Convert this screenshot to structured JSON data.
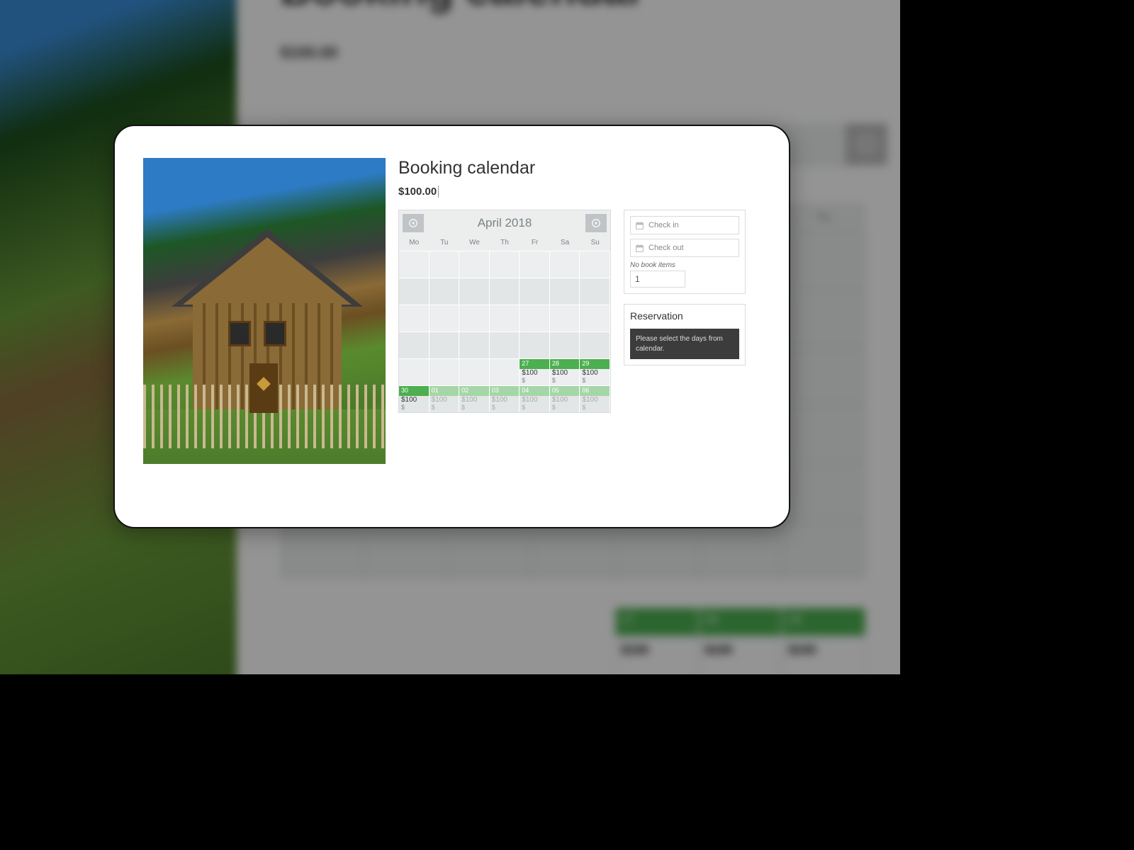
{
  "bg": {
    "title": "Booking calendar",
    "price": "$100.00",
    "dow": [
      "Mo",
      "Tu",
      "We",
      "Th",
      "Fr",
      "Sa",
      "Su"
    ],
    "avail_days": [
      "27",
      "28",
      "29"
    ],
    "avail_prices": [
      "$100",
      "$100",
      "$100"
    ]
  },
  "product": {
    "title": "Booking calendar",
    "price": "$100.00"
  },
  "calendar": {
    "month_label": "April 2018",
    "dow": [
      "Mo",
      "Tu",
      "We",
      "Th",
      "Fr",
      "Sa",
      "Su"
    ],
    "weeks": [
      [
        {
          "day": "",
          "type": "row-odd"
        },
        {
          "day": "",
          "type": "row-odd"
        },
        {
          "day": "",
          "type": "row-odd"
        },
        {
          "day": "",
          "type": "row-odd"
        },
        {
          "day": "",
          "type": "row-odd"
        },
        {
          "day": "",
          "type": "row-odd"
        },
        {
          "day": "",
          "type": "row-odd"
        }
      ],
      [
        {
          "day": "",
          "type": ""
        },
        {
          "day": "",
          "type": ""
        },
        {
          "day": "",
          "type": ""
        },
        {
          "day": "",
          "type": ""
        },
        {
          "day": "",
          "type": ""
        },
        {
          "day": "",
          "type": ""
        },
        {
          "day": "",
          "type": ""
        }
      ],
      [
        {
          "day": "",
          "type": "row-odd"
        },
        {
          "day": "",
          "type": "row-odd"
        },
        {
          "day": "",
          "type": "row-odd"
        },
        {
          "day": "",
          "type": "row-odd"
        },
        {
          "day": "",
          "type": "row-odd"
        },
        {
          "day": "",
          "type": "row-odd"
        },
        {
          "day": "",
          "type": "row-odd"
        }
      ],
      [
        {
          "day": "",
          "type": ""
        },
        {
          "day": "",
          "type": ""
        },
        {
          "day": "",
          "type": ""
        },
        {
          "day": "",
          "type": ""
        },
        {
          "day": "",
          "type": ""
        },
        {
          "day": "",
          "type": ""
        },
        {
          "day": "",
          "type": ""
        }
      ],
      [
        {
          "day": "",
          "type": "row-odd"
        },
        {
          "day": "",
          "type": "row-odd"
        },
        {
          "day": "",
          "type": "row-odd"
        },
        {
          "day": "",
          "type": "row-odd"
        },
        {
          "day": "27",
          "type": "row-odd avail",
          "price": "$100",
          "price2": "$"
        },
        {
          "day": "28",
          "type": "row-odd avail",
          "price": "$100",
          "price2": "$"
        },
        {
          "day": "29",
          "type": "row-odd avail",
          "price": "$100",
          "price2": "$"
        }
      ],
      [
        {
          "day": "30",
          "type": "avail",
          "price": "$100",
          "price2": "$"
        },
        {
          "day": "01",
          "type": "avail-light muted",
          "price": "$100",
          "price2": "$"
        },
        {
          "day": "02",
          "type": "avail-light muted",
          "price": "$100",
          "price2": "$"
        },
        {
          "day": "03",
          "type": "avail-light muted",
          "price": "$100",
          "price2": "$"
        },
        {
          "day": "04",
          "type": "avail-light muted",
          "price": "$100",
          "price2": "$"
        },
        {
          "day": "05",
          "type": "avail-light muted",
          "price": "$100",
          "price2": "$"
        },
        {
          "day": "06",
          "type": "avail-light muted",
          "price": "$100",
          "price2": "$"
        }
      ]
    ]
  },
  "sidebar": {
    "check_in_placeholder": "Check in",
    "check_out_placeholder": "Check out",
    "items_label": "No book items",
    "items_value": "1",
    "reservation_title": "Reservation",
    "notice": "Please select the days from calendar."
  }
}
